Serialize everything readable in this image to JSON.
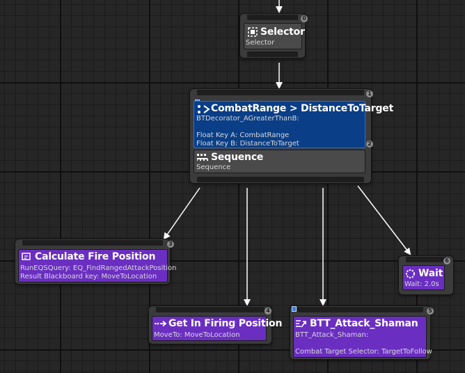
{
  "nodes": {
    "selector": {
      "title": "Selector",
      "subtitle": "Selector",
      "badge": "0",
      "icon": "selector-icon"
    },
    "combat": {
      "decorator_title": "CombatRange > DistanceToTarget",
      "decorator_class": "BTDecorator_AGreaterThanB:",
      "decorator_line_a": "Float Key A: CombatRange",
      "decorator_line_b": "Float Key B: DistanceToTarget",
      "decorator_badge": "1",
      "sequence_title": "Sequence",
      "sequence_subtitle": "Sequence",
      "sequence_badge": "2"
    },
    "calc_fire": {
      "title": "Calculate Fire Position",
      "line1": "RunEQSQuery: EQ_FindRangedAttackPosition",
      "line2": "Result Blackboard key: MoveToLocation",
      "badge": "3"
    },
    "get_in_firing": {
      "title": "Get In Firing Position",
      "line1": "MoveTo: MoveToLocation",
      "badge": "4"
    },
    "attack_shaman": {
      "title": "BTT_Attack_Shaman",
      "line1": "BTT_Attack_Shaman:",
      "line2": "Combat Target Selector: TargetToFollow",
      "badge": "5"
    },
    "wait": {
      "title": "Wait",
      "line1": "Wait: 2.0s",
      "badge": "6"
    }
  },
  "colors": {
    "canvas": "#262626",
    "node_body": "#3b3b3b",
    "composite_gray": "#4a4a4a",
    "task_purple": "#6a2ec1",
    "decorator_blue": "#0a3e86",
    "wire": "#ffffff"
  }
}
